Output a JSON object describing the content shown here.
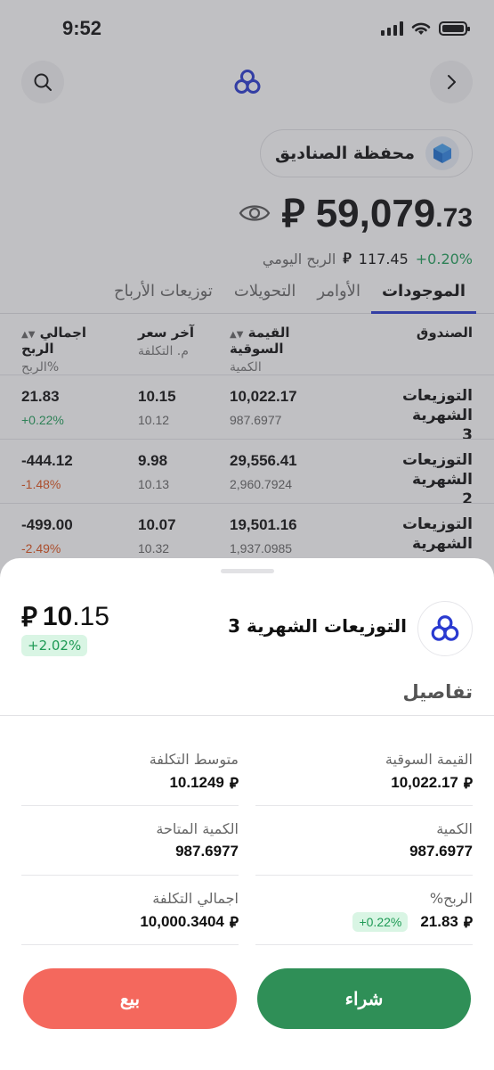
{
  "status_bar": {
    "time": "9:52"
  },
  "portfolio": {
    "name": "محفظة الصناديق",
    "balance_int": "59,079",
    "balance_dec": ".73",
    "currency_symbol": "⃁",
    "daily_profit_label": "الربح اليومي",
    "daily_profit_value": "117.45",
    "daily_profit_pct": "+0.20%"
  },
  "tabs": [
    {
      "label": "الموجودات",
      "active": true
    },
    {
      "label": "الأوامر",
      "active": false
    },
    {
      "label": "التحويلات",
      "active": false
    },
    {
      "label": "توزيعات الأرباح",
      "active": false
    }
  ],
  "table": {
    "headers": {
      "fund": "الصندوق",
      "market_value": "القيمة السوقية",
      "quantity": "الكمية",
      "last_price": "آخر سعر",
      "avg_cost": "م. التكلفة",
      "total_profit": "اجمالي الربح",
      "profit_pct": "الربح%"
    },
    "rows": [
      {
        "fund_line1": "التوزيعات الشهرية",
        "fund_line2": "3",
        "market_value": "10,022.17",
        "quantity": "987.6977",
        "last_price": "10.15",
        "avg_cost": "10.12",
        "profit": "21.83",
        "profit_pct": "+0.22%"
      },
      {
        "fund_line1": "التوزيعات الشهرية",
        "fund_line2": "2",
        "market_value": "29,556.41",
        "quantity": "2,960.7924",
        "last_price": "9.98",
        "avg_cost": "10.13",
        "profit": "-444.12",
        "profit_pct": "-1.48%"
      },
      {
        "fund_line1": "التوزيعات الشهرية",
        "fund_line2": "",
        "market_value": "19,501.16",
        "quantity": "1,937.0985",
        "last_price": "10.07",
        "avg_cost": "10.32",
        "profit": "-499.00",
        "profit_pct": "-2.49%"
      }
    ]
  },
  "sheet": {
    "fund_name": "التوزيعات الشهرية 3",
    "price_int": "10",
    "price_dec": ".15",
    "change_pct": "+2.02%",
    "details_title": "تفاصيل",
    "details": {
      "market_value_label": "القيمة السوقية",
      "market_value": "10,022.17",
      "avg_cost_label": "متوسط التكلفة",
      "avg_cost": "10.1249",
      "quantity_label": "الكمية",
      "quantity": "987.6977",
      "available_qty_label": "الكمية المتاحة",
      "available_qty": "987.6977",
      "profit_label": "%الربح",
      "profit": "21.83",
      "profit_pct": "+0.22%",
      "total_cost_label": "اجمالي التكلفة",
      "total_cost": "10,000.3404"
    },
    "buy_label": "شراء",
    "sell_label": "بيع"
  },
  "colors": {
    "accent": "#2a3ad0",
    "positive": "#22a05b",
    "negative": "#e0521b",
    "buy": "#2f8f57",
    "sell": "#f4685d"
  },
  "icons": [
    "search-icon",
    "brand-logo-icon",
    "chevron-right-icon",
    "cube-icon",
    "eye-icon",
    "sort-icon",
    "riyal-icon"
  ]
}
